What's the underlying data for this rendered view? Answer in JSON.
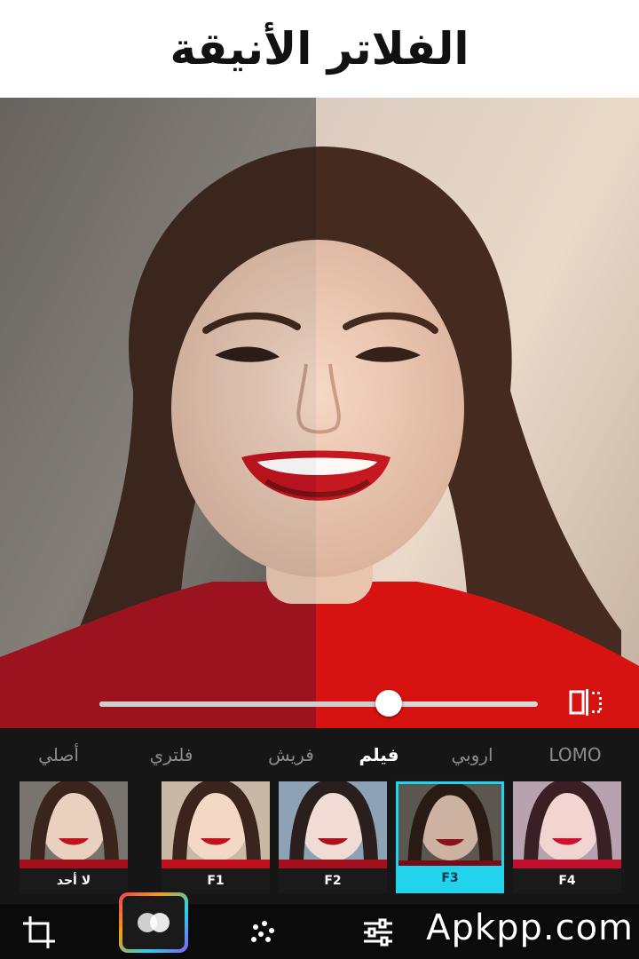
{
  "banner": {
    "title": "الفلاتر الأنيقة"
  },
  "editor": {
    "compare_slider_value": 0.66,
    "compare_icon": "split-compare-icon"
  },
  "filters": {
    "categories": [
      {
        "label": "أصلي",
        "active": false
      },
      {
        "label": "فلتري",
        "active": false
      },
      {
        "label": "فريش",
        "active": false
      },
      {
        "label": "فيلم",
        "active": true
      },
      {
        "label": "اروبي",
        "active": false
      },
      {
        "label": "LOMO",
        "active": false
      }
    ],
    "thumbnails": [
      {
        "label": "لا أحد",
        "selected": false
      },
      {
        "label": "F1",
        "selected": false
      },
      {
        "label": "F2",
        "selected": false
      },
      {
        "label": "F3",
        "selected": true
      },
      {
        "label": "F4",
        "selected": false
      }
    ],
    "accent_color": "#22d3ee"
  },
  "toolbar": {
    "items": [
      "crop-icon",
      "filter-icon",
      "effects-icon",
      "adjust-icon"
    ],
    "active": "filter-icon"
  },
  "watermark": {
    "text": "Apkpp.com"
  }
}
